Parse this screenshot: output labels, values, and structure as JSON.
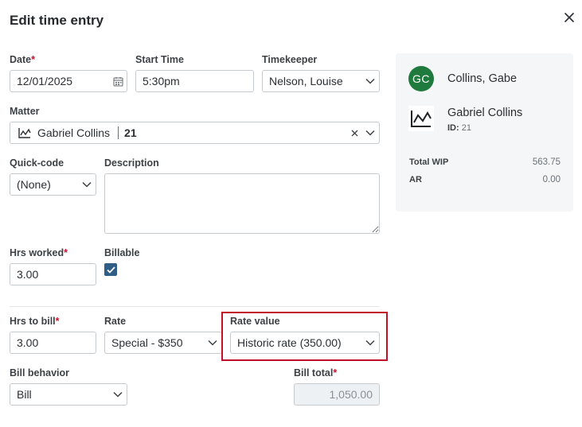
{
  "dialog": {
    "title": "Edit time entry"
  },
  "date": {
    "label": "Date",
    "required_mark": "*",
    "value": "12/01/2025"
  },
  "start_time": {
    "label": "Start Time",
    "value": "5:30pm"
  },
  "timekeeper": {
    "label": "Timekeeper",
    "value": "Nelson, Louise"
  },
  "matter": {
    "label": "Matter",
    "name": "Gabriel Collins",
    "number": "21"
  },
  "quick_code": {
    "label": "Quick-code",
    "value": "(None)"
  },
  "description": {
    "label": "Description",
    "value": ""
  },
  "hrs_worked": {
    "label": "Hrs worked",
    "required_mark": "*",
    "value": "3.00"
  },
  "billable": {
    "label": "Billable",
    "checked": true
  },
  "hrs_to_bill": {
    "label": "Hrs to bill",
    "required_mark": "*",
    "value": "3.00"
  },
  "rate": {
    "label": "Rate",
    "value": "Special - $350"
  },
  "rate_value": {
    "label": "Rate value",
    "value": "Historic rate (350.00)"
  },
  "bill_behavior": {
    "label": "Bill behavior",
    "value": "Bill"
  },
  "bill_total": {
    "label": "Bill total",
    "required_mark": "*",
    "value": "1,050.00"
  },
  "side_panel": {
    "avatar_initials": "GC",
    "avatar_color": "#1f7a3d",
    "client_name": "Collins, Gabe",
    "matter_name": "Gabriel Collins",
    "id_label": "ID:",
    "id_value": "21",
    "stats": [
      {
        "label": "Total WIP",
        "value": "563.75"
      },
      {
        "label": "AR",
        "value": "0.00"
      }
    ]
  },
  "colors": {
    "accent": "#2e5e86",
    "required": "#c8102e",
    "highlight": "#c0102a"
  }
}
